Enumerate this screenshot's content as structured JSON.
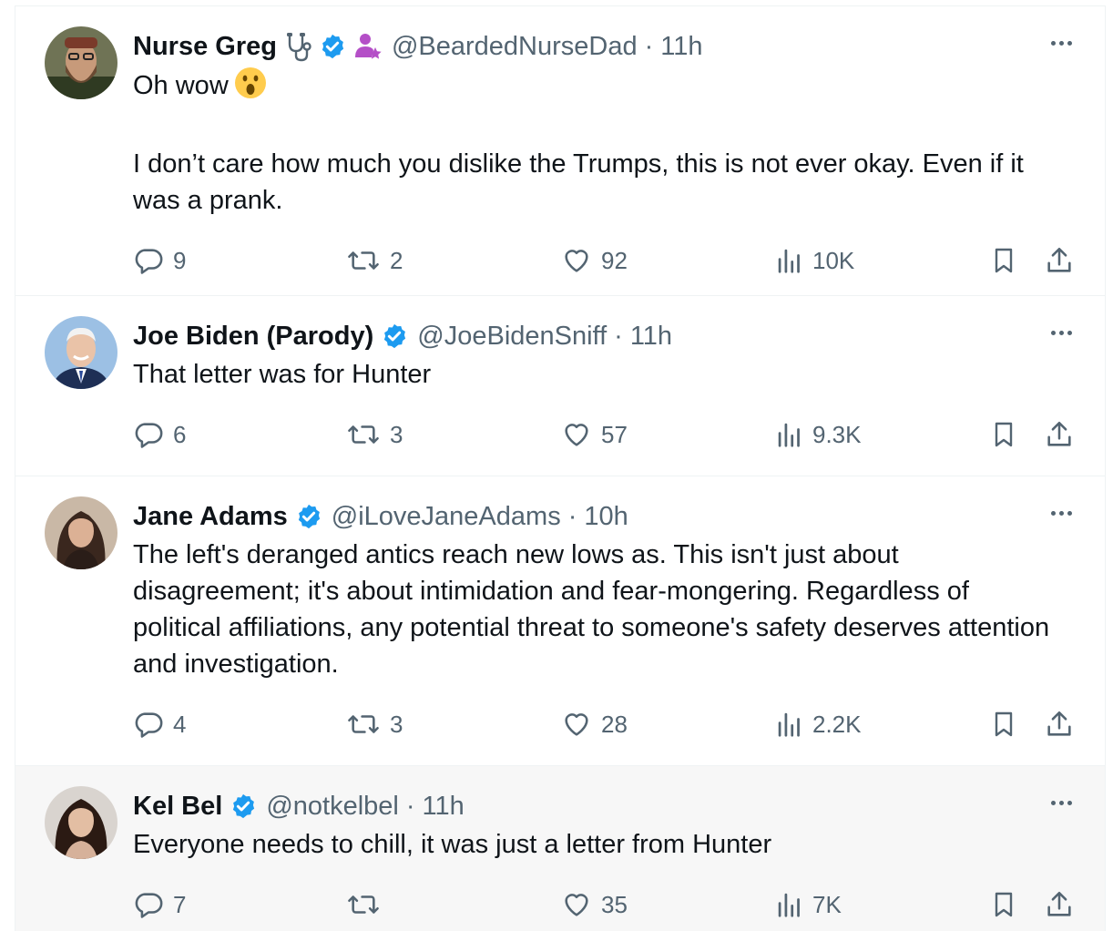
{
  "tweets": [
    {
      "name": "Nurse Greg",
      "handle": "@BeardedNurseDad",
      "separator": "·",
      "time": "11h",
      "text": "Oh wow",
      "text2": "I don’t care how much you dislike the Trumps, this is not ever okay. Even if it was a prank.",
      "replies": "9",
      "retweets": "2",
      "likes": "92",
      "views": "10K",
      "avatar_colors": [
        "#5a5a3e",
        "#8a6a4a"
      ]
    },
    {
      "name": "Joe Biden (Parody)",
      "handle": "@JoeBidenSniff",
      "separator": "·",
      "time": "11h",
      "text": "That letter was for Hunter",
      "replies": "6",
      "retweets": "3",
      "likes": "57",
      "views": "9.3K",
      "avatar_colors": [
        "#8fb3d9",
        "#f1d2bd"
      ]
    },
    {
      "name": "Jane Adams",
      "handle": "@iLoveJaneAdams",
      "separator": "·",
      "time": "10h",
      "text": "The left's deranged antics reach new lows as. This isn't just about disagreement; it's about intimidation and fear-mongering. Regardless of political affiliations, any potential threat to someone's safety deserves attention and investigation.",
      "replies": "4",
      "retweets": "3",
      "likes": "28",
      "views": "2.2K",
      "avatar_colors": [
        "#3a2a22",
        "#d9b49a"
      ]
    },
    {
      "name": "Kel Bel",
      "handle": "@notkelbel",
      "separator": "·",
      "time": "11h",
      "text": "Everyone needs to chill, it was just a letter from Hunter",
      "replies": "7",
      "retweets": "",
      "likes": "35",
      "views": "7K",
      "avatar_colors": [
        "#2a1a14",
        "#e0bca2"
      ]
    }
  ],
  "colors": {
    "verified": "#1d9bf0",
    "text": "#0f1419",
    "muted": "#536471",
    "divider": "#eff3f4",
    "badge_purple": "#b44fc7"
  },
  "icons": {
    "name_extras_tweet1": [
      "stethoscope-icon",
      "verified-badge-icon",
      "person-star-icon"
    ],
    "emoji_tweet1": "astonished-face-emoji",
    "actions": [
      "reply-icon",
      "retweet-icon",
      "like-icon",
      "views-icon",
      "bookmark-icon",
      "share-icon"
    ],
    "more": "more-options-icon"
  }
}
